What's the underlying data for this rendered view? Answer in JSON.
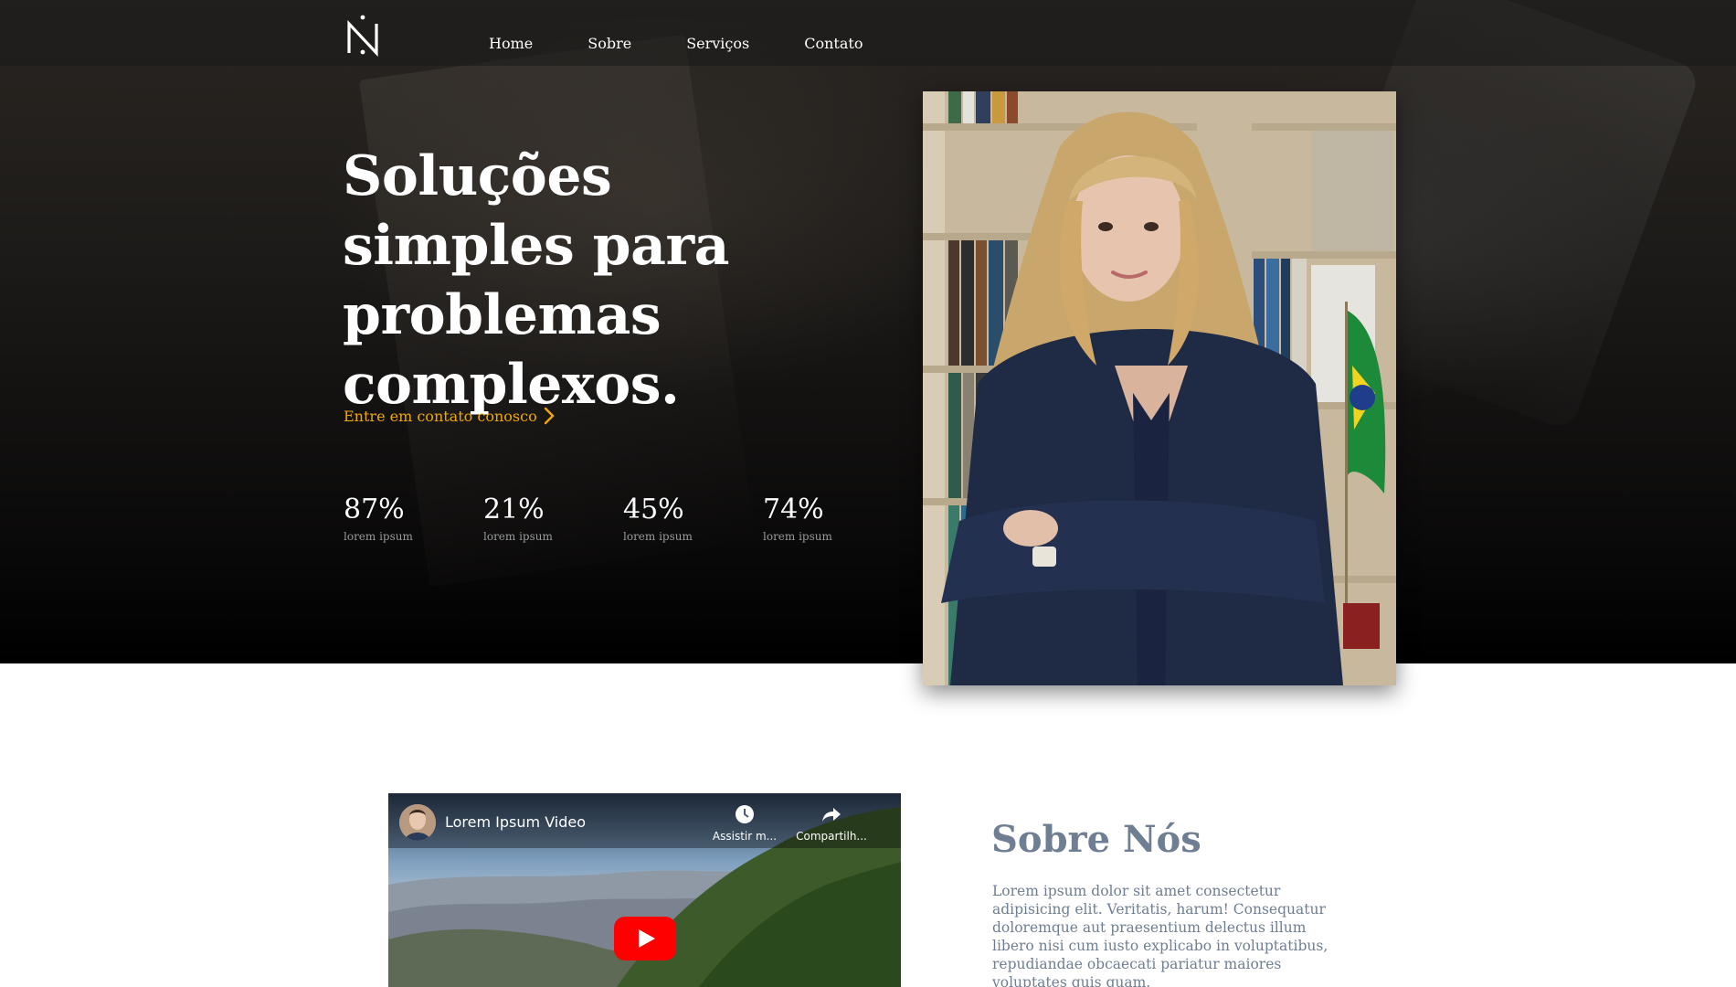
{
  "nav": {
    "logo_icon": "n-monogram-logo",
    "links": [
      {
        "label": "Home"
      },
      {
        "label": "Sobre"
      },
      {
        "label": "Serviços"
      },
      {
        "label": "Contato"
      }
    ]
  },
  "hero": {
    "headline": "Soluções simples para problemas complexos.",
    "cta_label": "Entre em contato conosco",
    "cta_icon": "chevron-right-icon",
    "stats": [
      {
        "value": "87%",
        "label": "lorem ipsum"
      },
      {
        "value": "21%",
        "label": "lorem ipsum"
      },
      {
        "value": "45%",
        "label": "lorem ipsum"
      },
      {
        "value": "74%",
        "label": "lorem ipsum"
      }
    ]
  },
  "about": {
    "video": {
      "title": "Lorem Ipsum Video",
      "watch_later_label": "Assistir m...",
      "share_label": "Compartilh..."
    },
    "title": "Sobre Nós",
    "body": "Lorem ipsum dolor sit amet consectetur adipisicing elit. Veritatis, harum! Consequatur doloremque aut praesentium delectus illum libero nisi cum iusto explicabo in voluptatibus, repudiandae obcaecati pariatur maiores voluptates quis quam."
  },
  "colors": {
    "accent": "#f0a800",
    "about_text": "#6f7e92",
    "hero_bg": "#0b0a0a",
    "youtube_red": "#ff0000"
  }
}
